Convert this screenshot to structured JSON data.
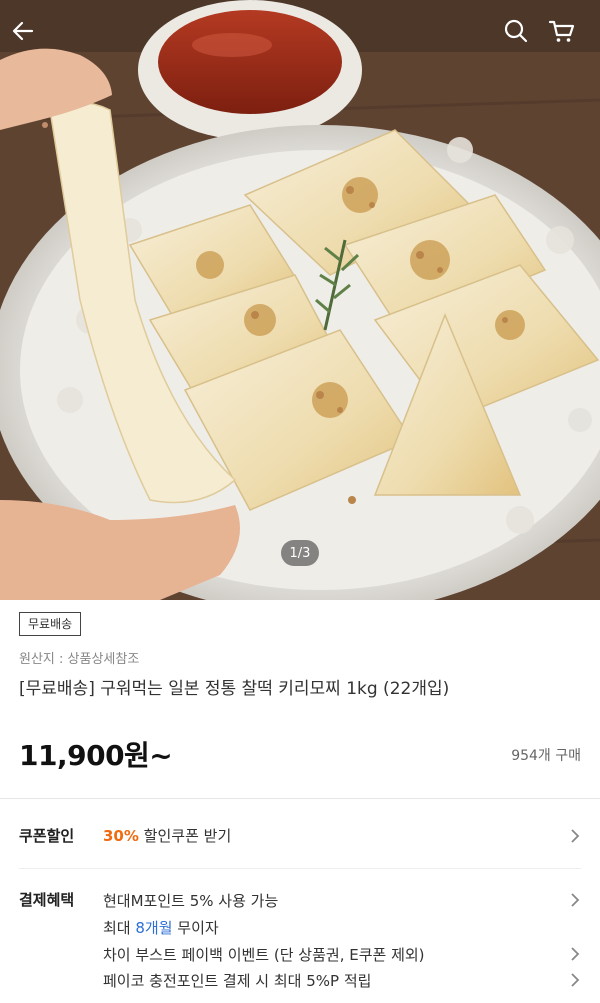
{
  "header": {
    "back_icon": "arrow-left-icon",
    "search_icon": "search-icon",
    "cart_icon": "cart-icon"
  },
  "gallery": {
    "counter": "1/3"
  },
  "product": {
    "badge": "무료배송",
    "origin": "원산지 : 상품상세참조",
    "title": "[무료배송] 구워먹는 일본 정통 찰떡 키리모찌 1kg (22개입)",
    "price": "11,900원~",
    "sold_count": "954개 구매"
  },
  "coupon": {
    "label": "쿠폰할인",
    "percent": "30%",
    "text": " 할인쿠폰 받기"
  },
  "payment": {
    "label": "결제혜택",
    "lines": [
      {
        "text": "현대M포인트 5% 사용 가능"
      },
      {
        "prefix": "최대 ",
        "highlight": "8개월",
        "suffix": " 무이자"
      },
      {
        "text": "차이 부스트 페이백 이벤트 (단 상품권, E쿠폰 제외)"
      },
      {
        "text": "페이코 충전포인트 결제 시 최대 5%P 적립"
      }
    ]
  },
  "colors": {
    "accent_orange": "#f06a12",
    "accent_blue": "#2e6fd6"
  }
}
